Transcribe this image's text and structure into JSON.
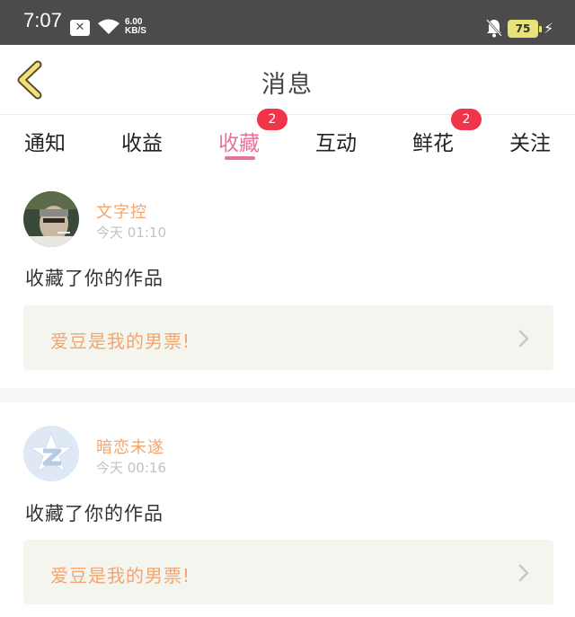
{
  "status_bar": {
    "time": "7:07",
    "notif_icon": "x-notification-icon",
    "speed_value": "6.00",
    "speed_unit": "KB/S",
    "battery": "75"
  },
  "header": {
    "title": "消息"
  },
  "tabs": [
    {
      "label": "通知",
      "badge": ""
    },
    {
      "label": "收益",
      "badge": ""
    },
    {
      "label": "收藏",
      "badge": "2"
    },
    {
      "label": "互动",
      "badge": ""
    },
    {
      "label": "鲜花",
      "badge": "2"
    },
    {
      "label": "关注",
      "badge": ""
    }
  ],
  "active_tab": "收藏",
  "colors": {
    "accent": "#e7739b",
    "name": "#f3a56f",
    "badge": "#f0344a",
    "card_bg": "#f5f5ef"
  },
  "messages": [
    {
      "user": "文字控",
      "time": "今天 01:10",
      "action": "收藏了你的作品",
      "work_title": "爱豆是我的男票!"
    },
    {
      "user": "暗恋未遂",
      "time": "今天 00:16",
      "action": "收藏了你的作品",
      "work_title": "爱豆是我的男票!"
    }
  ]
}
